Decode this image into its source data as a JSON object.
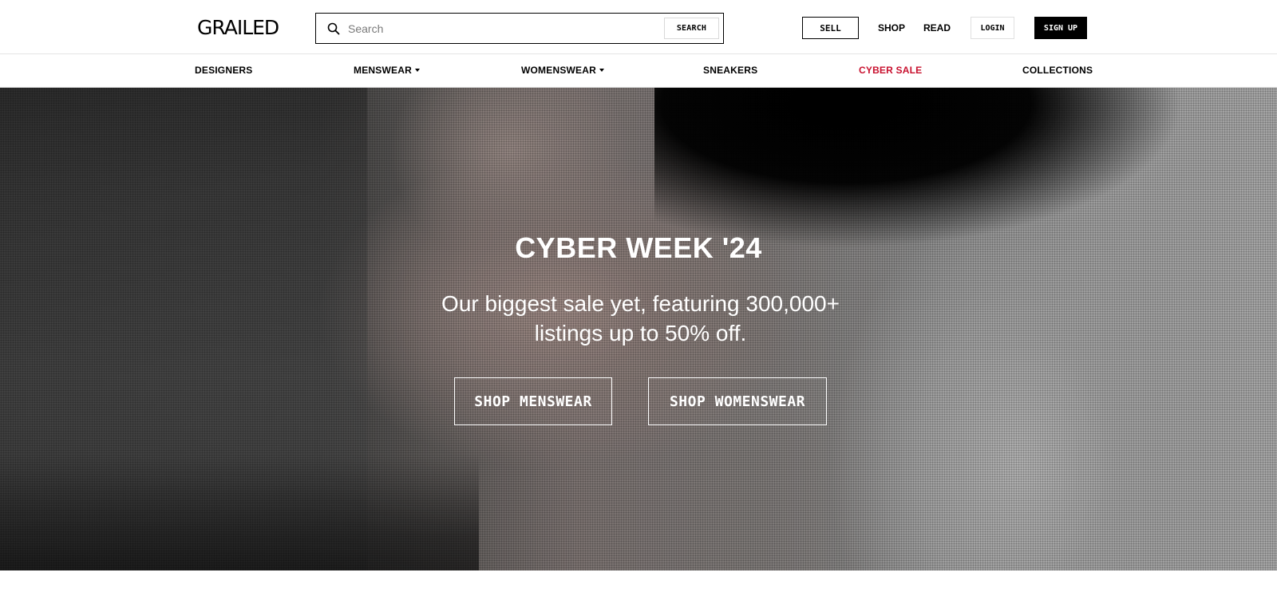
{
  "header": {
    "logo": "GRAILED",
    "search": {
      "placeholder": "Search",
      "button_label": "SEARCH",
      "icon": "search-icon"
    },
    "nav": {
      "sell": "SELL",
      "shop": "SHOP",
      "read": "READ",
      "login": "LOGIN",
      "signup": "SIGN UP"
    }
  },
  "categories": {
    "designers": "DESIGNERS",
    "menswear": "MENSWEAR",
    "womenswear": "WOMENSWEAR",
    "sneakers": "SNEAKERS",
    "cyber_sale": "CYBER SALE",
    "collections": "COLLECTIONS"
  },
  "hero": {
    "title": "CYBER WEEK '24",
    "subtitle": "Our biggest sale yet, featuring 300,000+ listings up to 50% off.",
    "shop_menswear": "SHOP MENSWEAR",
    "shop_womenswear": "SHOP WOMENSWEAR"
  },
  "colors": {
    "accent_sale": "#c8102e",
    "primary": "#000000",
    "background": "#ffffff"
  }
}
